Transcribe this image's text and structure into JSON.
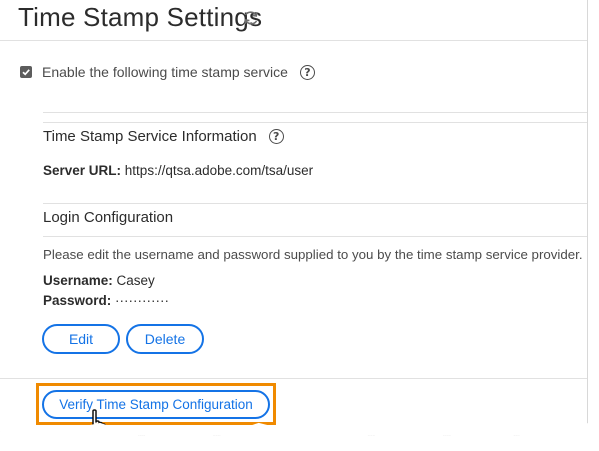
{
  "page": {
    "title": "Time Stamp Settings",
    "refresh_icon": "refresh-icon"
  },
  "enable": {
    "checked": true,
    "label": "Enable the following time stamp service",
    "help_icon": "question-circle-icon"
  },
  "service_info": {
    "title": "Time Stamp Service Information",
    "help_icon": "question-circle-icon",
    "server_url_label": "Server URL:",
    "server_url_value": "https://qtsa.adobe.com/tsa/user"
  },
  "login": {
    "title": "Login Configuration",
    "description": "Please edit the username and password supplied to you by the time stamp service provider.",
    "username_label": "Username:",
    "username_value": "Casey",
    "password_label": "Password:",
    "password_value": "············"
  },
  "buttons": {
    "edit": "Edit",
    "delete": "Delete",
    "verify": "Verify Time Stamp Configuration"
  },
  "colors": {
    "accent": "#1473e6",
    "highlight": "#f08a00",
    "text": "#2c2c2c"
  }
}
